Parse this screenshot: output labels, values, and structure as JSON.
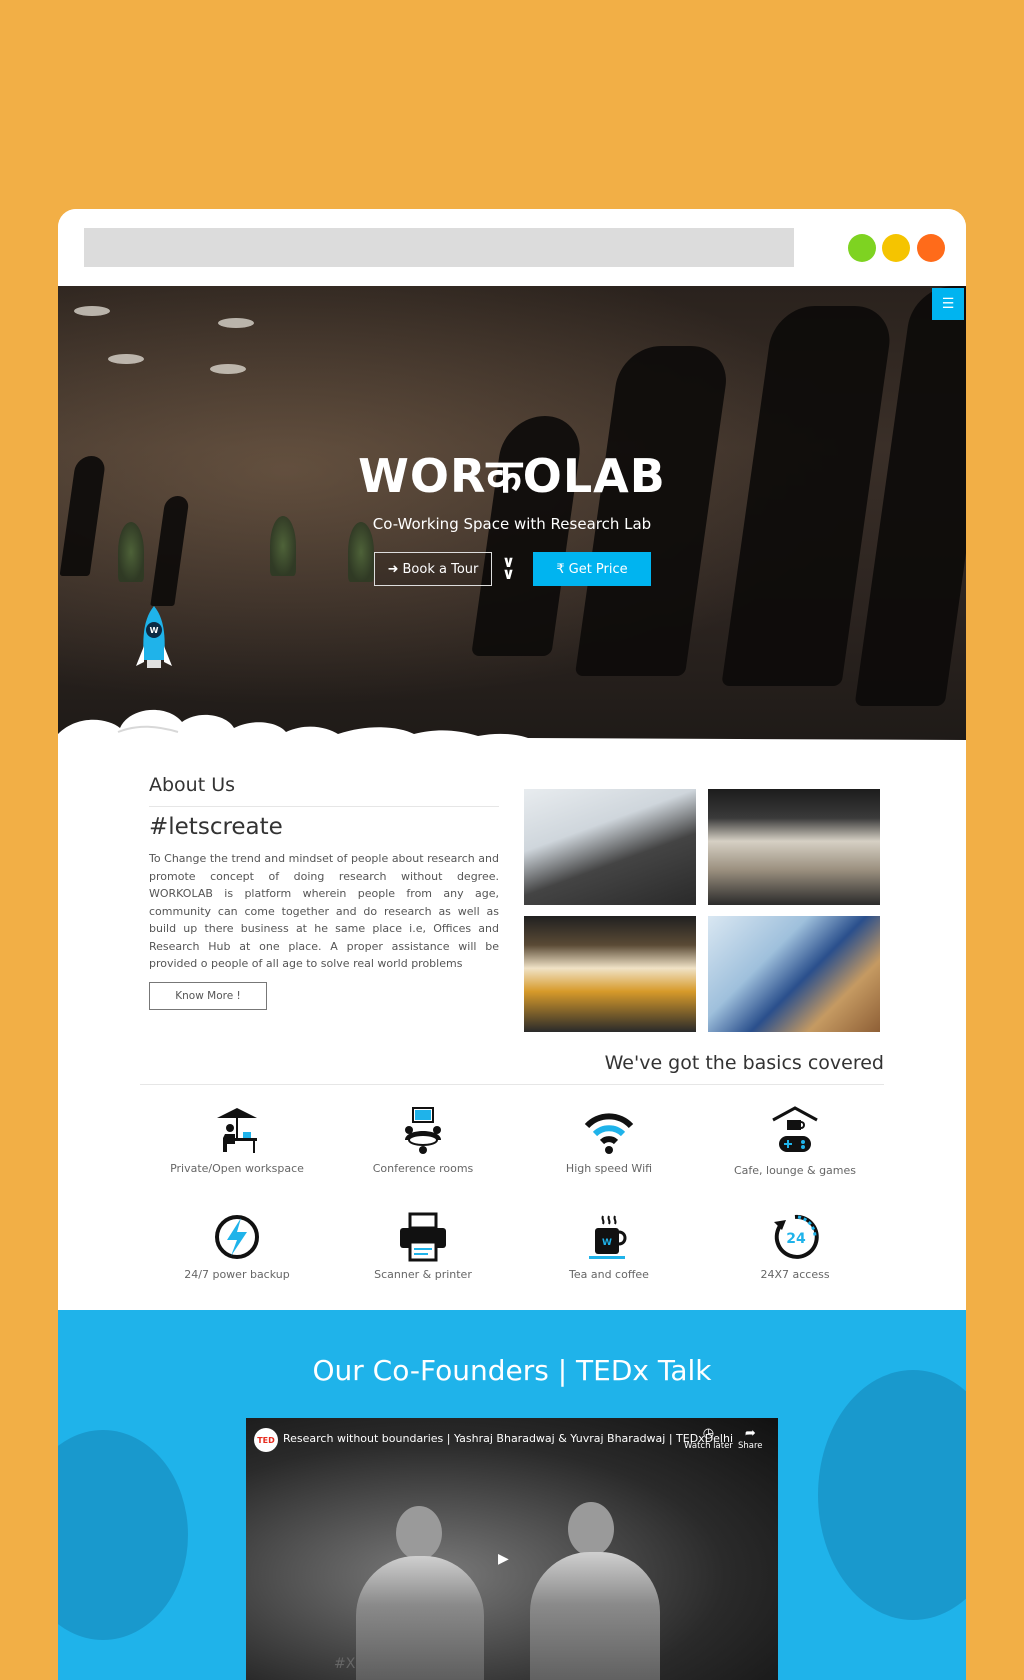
{
  "browser": {
    "dots": {
      "green": "#7ED321",
      "yellow": "#F5C400",
      "orange": "#FF6B1A"
    }
  },
  "hero": {
    "logo_text": "WORकOLAB",
    "tagline": "Co-Working Space with Research Lab",
    "book_tour_label": "Book a Tour",
    "get_price_label": "Get Price",
    "menu_icon": "hamburger-icon",
    "rocket_badge": "W",
    "accent": "#00B4F0"
  },
  "about": {
    "title": "About Us",
    "hashtag": "#letscreate",
    "body": "To Change the trend and mindset of people about research and promote concept of doing research without degree. WORKOLAB is platform wherein people from any age, community can come together and do research as well as build up there business at he same place i.e, Offices and Research Hub at one place. A proper assistance will be provided o people of all age to solve real world problems",
    "know_more_label": "Know More !"
  },
  "basics": {
    "title": "We've got the basics covered",
    "features": [
      {
        "label": "Private/Open workspace",
        "icon": "workspace-icon"
      },
      {
        "label": "Conference rooms",
        "icon": "conference-icon"
      },
      {
        "label": "High speed Wifi",
        "icon": "wifi-icon"
      },
      {
        "label": "Cafe, lounge & games",
        "icon": "cafe-games-icon"
      },
      {
        "label": "24/7 power backup",
        "icon": "power-icon"
      },
      {
        "label": "Scanner & printer",
        "icon": "printer-icon"
      },
      {
        "label": "Tea and coffee",
        "icon": "coffee-icon"
      },
      {
        "label": "24X7 access",
        "icon": "access-24-icon"
      }
    ],
    "access_badge": "24",
    "coffee_badge": "W"
  },
  "ted": {
    "title": "Our Co-Founders | TEDx Talk",
    "video_title": "Research without boundaries | Yashraj Bharadwaj & Yuvraj Bharadwaj | TEDxDelhi",
    "ted_badge": "TED",
    "watch_later_label": "Watch later",
    "share_label": "Share",
    "stage_text": "#X",
    "background": "#1FB3EA"
  }
}
